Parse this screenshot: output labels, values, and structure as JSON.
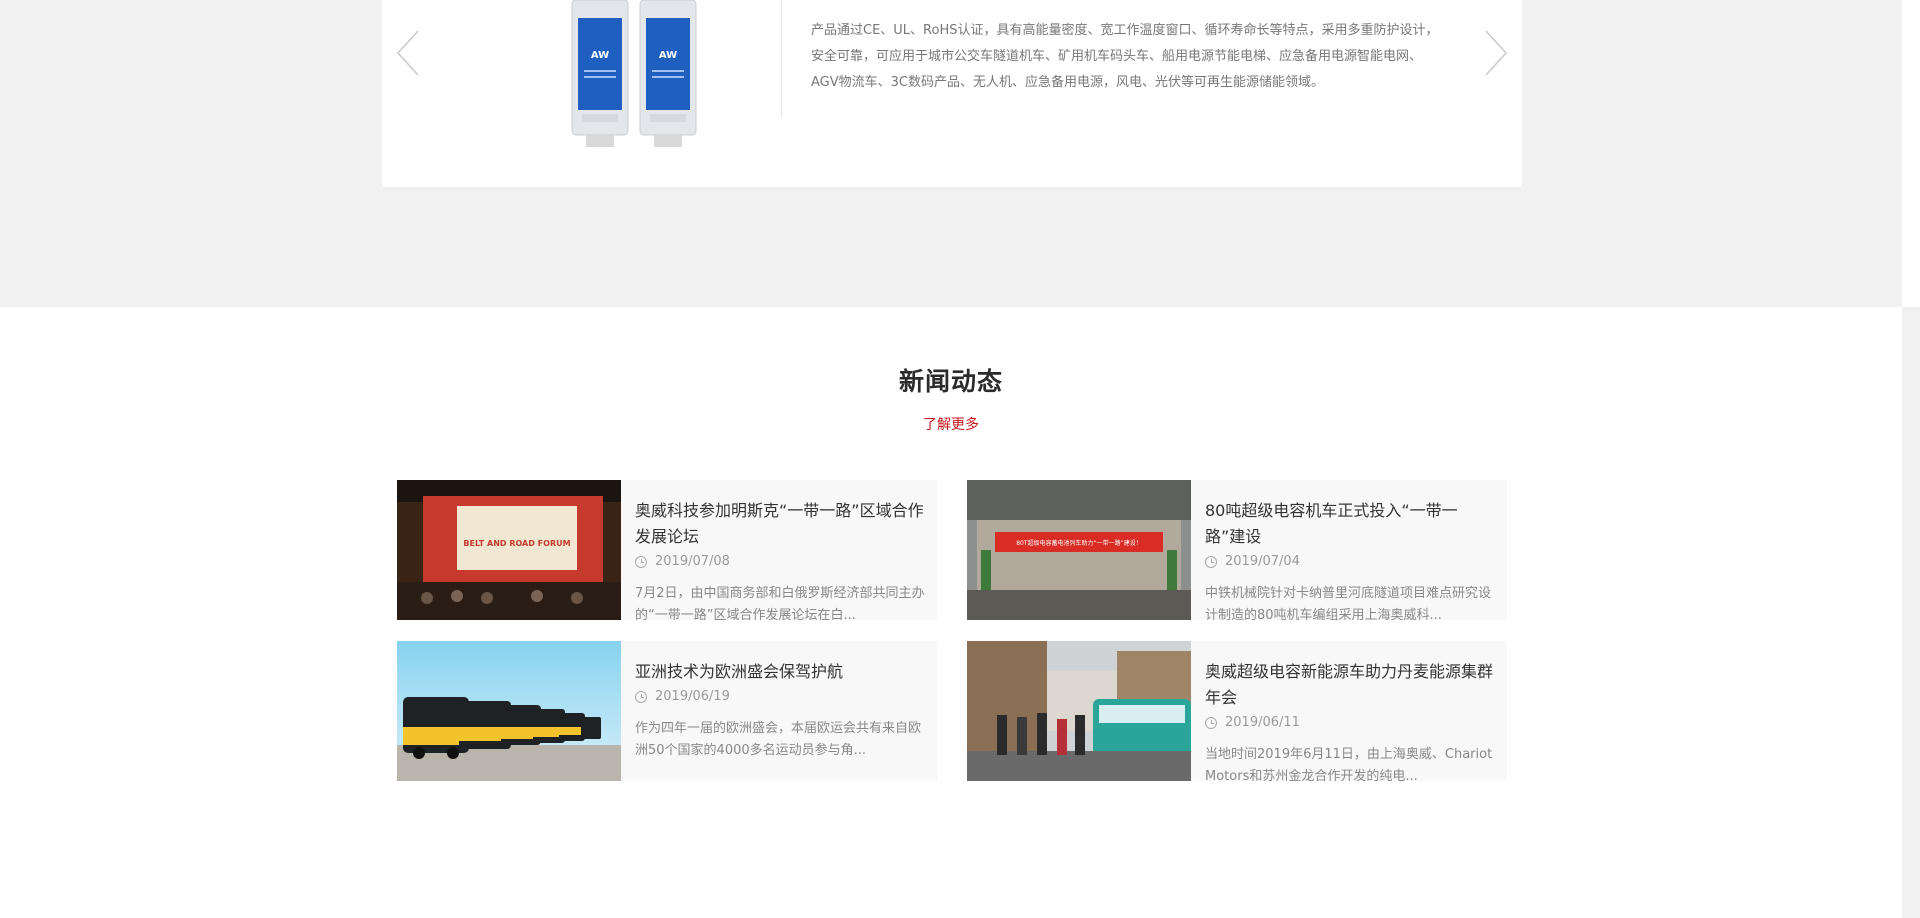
{
  "product": {
    "description": "产品通过CE、UL、RoHS认证，具有高能量密度、宽工作温度窗口、循环寿命长等特点，采用多重防护设计，安全可靠，可应用于城市公交车隧道机车、矿用机车码头车、船用电源节能电梯、应急备用电源智能电网、AGV物流车、3C数码产品、无人机、应急备用电源，风电、光伏等可再生能源储能领域。",
    "image_label": "AW"
  },
  "news": {
    "title": "新闻动态",
    "more_label": "了解更多",
    "items": [
      {
        "headline": "奥威科技参加明斯克“一带一路”区域合作发展论坛",
        "date": "2019/07/08",
        "excerpt": "7月2日，由中国商务部和白俄罗斯经济部共同主办的“一带一路”区域合作发展论坛在白...",
        "thumb_text": "BELT AND ROAD FORUM"
      },
      {
        "headline": "80吨超级电容机车正式投入“一带一路”建设",
        "date": "2019/07/04",
        "excerpt": "中铁机械院针对卡纳普里河底隧道项目难点研究设计制造的80吨机车编组采用上海奥威科...",
        "thumb_text": "80T超级电容蓄电池列车助力“一带一路”建设！"
      },
      {
        "headline": "亚洲技术为欧洲盛会保驾护航",
        "date": "2019/06/19",
        "excerpt": "作为四年一届的欧洲盛会，本届欧运会共有来自欧洲50个国家的4000多名运动员参与角..."
      },
      {
        "headline": "奥威超级电容新能源车助力丹麦能源集群年会",
        "date": "2019/06/11",
        "excerpt": "当地时间2019年6月11日，由上海奥威、Chariot Motors和苏州金龙合作开发的纯电..."
      }
    ]
  },
  "colors": {
    "accent": "#c8161d",
    "band_bg": "#f1f1f1",
    "card_bg": "#f8f8f8"
  }
}
